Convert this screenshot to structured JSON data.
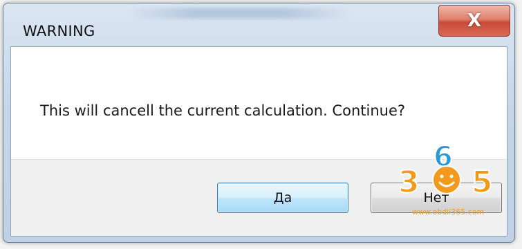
{
  "dialog": {
    "title": "WARNING",
    "close_label": "X",
    "message": "This will cancell the current calculation. Continue?",
    "buttons": {
      "yes_label": "Да",
      "no_label": "Нет"
    }
  },
  "watermark": {
    "digit_left": "3",
    "digit_middle": "6",
    "digit_right": "5",
    "url": "www.obdii365.com",
    "color": "#f39a1d"
  },
  "colors": {
    "close_button": "#c94b37",
    "default_button_border": "#3c7fb1"
  }
}
